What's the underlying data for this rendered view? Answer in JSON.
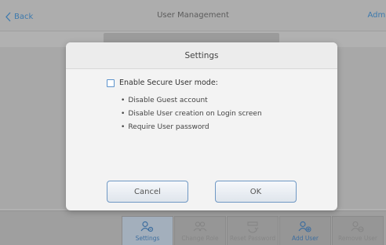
{
  "header": {
    "back_label": "Back",
    "title": "User Management",
    "right_label": "Admi"
  },
  "toolbar": {
    "items": [
      {
        "label": "Settings",
        "icon": "user-gear-icon",
        "state": "active"
      },
      {
        "label": "Change Role",
        "icon": "users-icon",
        "state": "disabled"
      },
      {
        "label": "Reset Password",
        "icon": "reset-password-icon",
        "state": "disabled"
      },
      {
        "label": "Add User",
        "icon": "user-add-icon",
        "state": "enabled"
      },
      {
        "label": "Remove User",
        "icon": "user-remove-icon",
        "state": "disabled"
      }
    ]
  },
  "dialog": {
    "title": "Settings",
    "option_label": "Enable Secure User mode:",
    "option_checked": false,
    "bullets": [
      "Disable Guest account",
      "Disable User creation on Login screen",
      "Require User password"
    ],
    "cancel_label": "Cancel",
    "ok_label": "OK"
  },
  "colors": {
    "accent": "#3c8fd6",
    "button_border": "#6f98c4"
  }
}
